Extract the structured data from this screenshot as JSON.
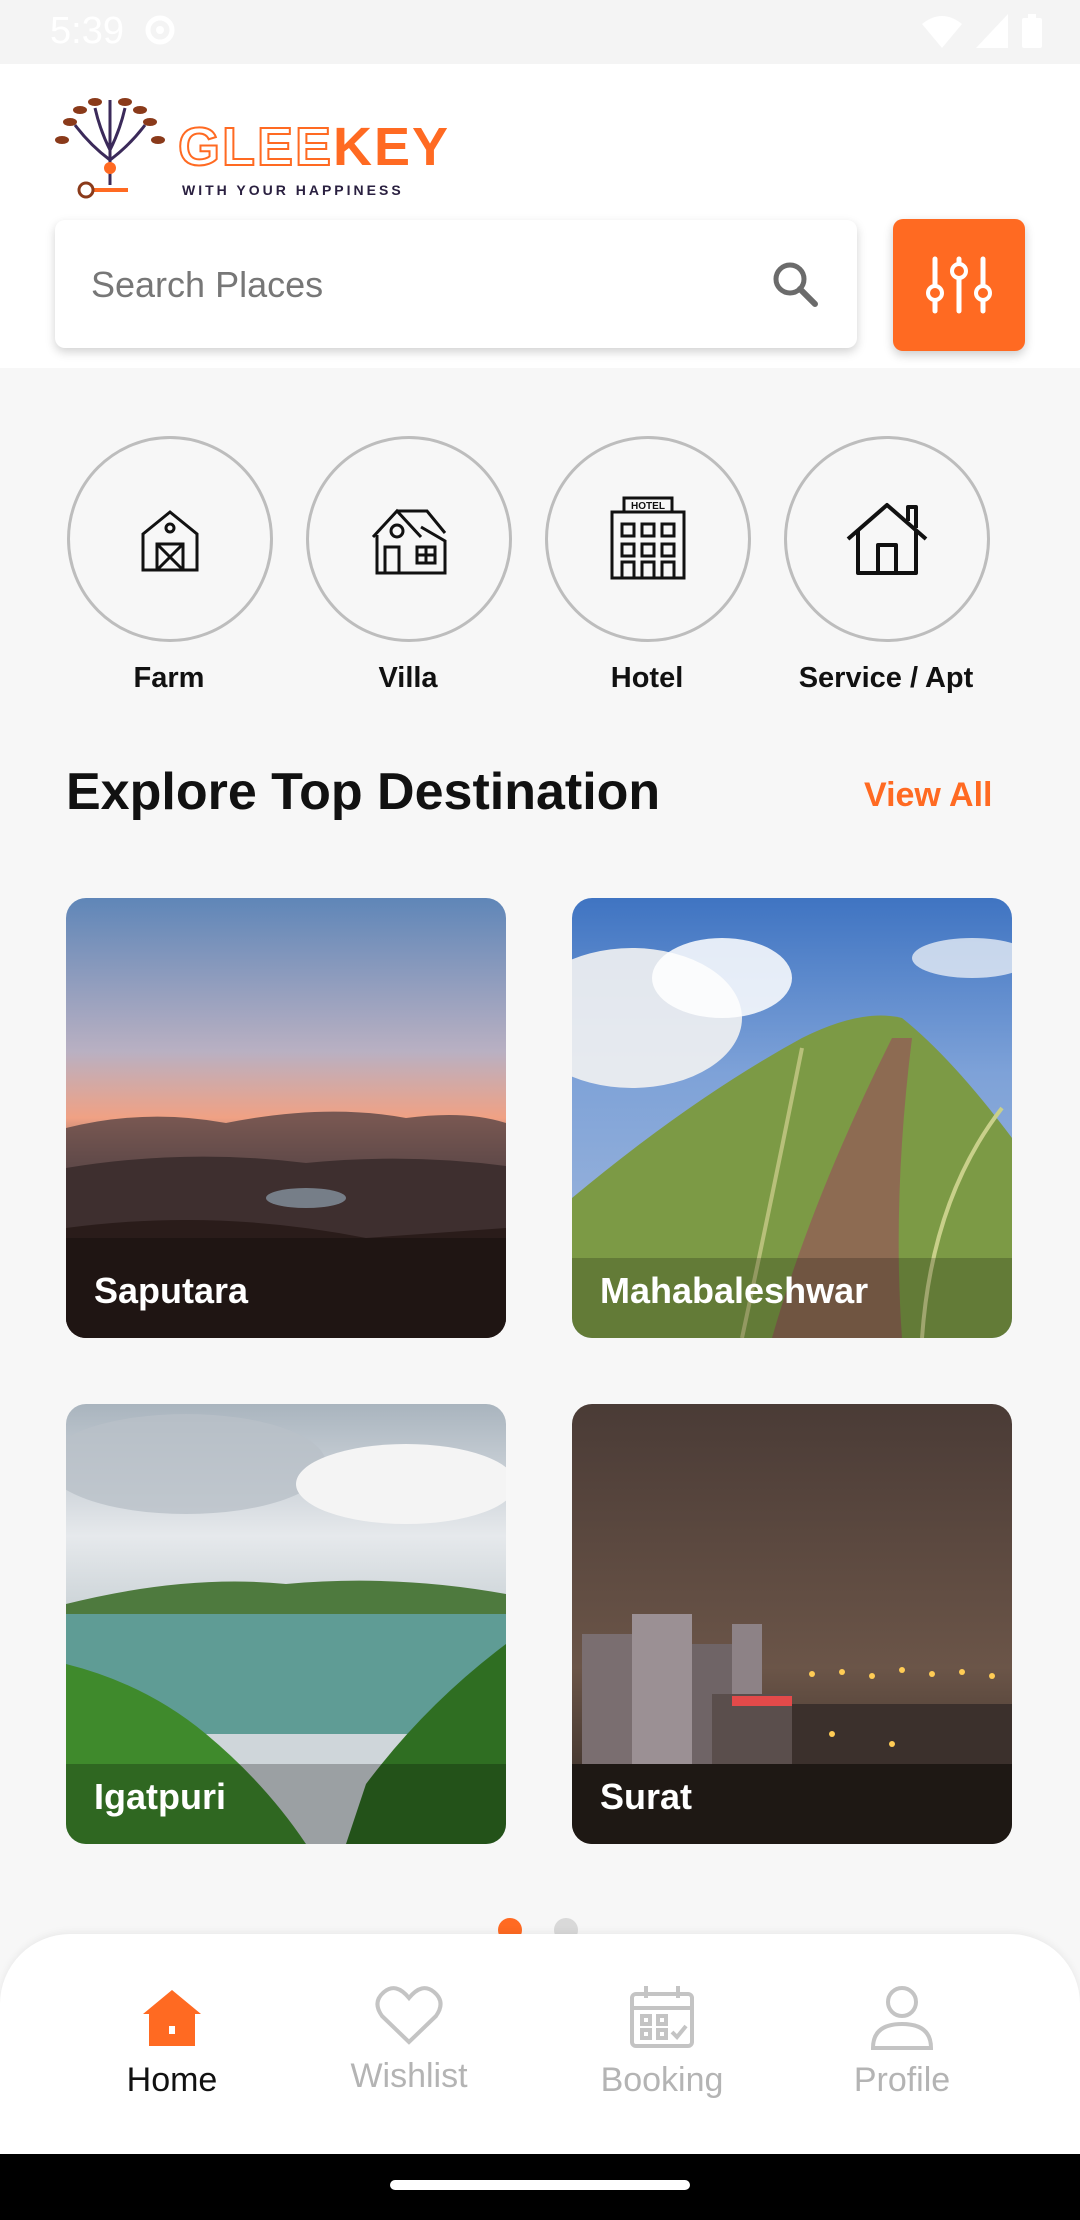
{
  "status_bar": {
    "time": "5:39"
  },
  "brand": {
    "name_part1": "GLEE",
    "name_part2": "KEY",
    "tagline": "WITH YOUR HAPPINESS"
  },
  "search": {
    "placeholder": "Search Places"
  },
  "categories": [
    {
      "label": "Farm",
      "icon": "barn-icon"
    },
    {
      "label": "Villa",
      "icon": "villa-icon"
    },
    {
      "label": "Hotel",
      "icon": "hotel-icon",
      "badge": "HOTEL"
    },
    {
      "label": "Service / Apt",
      "icon": "house-icon"
    }
  ],
  "section": {
    "title": "Explore Top Destination",
    "view_all": "View All"
  },
  "destinations": [
    {
      "name": "Saputara"
    },
    {
      "name": "Mahabaleshwar"
    },
    {
      "name": "Igatpuri"
    },
    {
      "name": "Surat"
    }
  ],
  "pager": {
    "pages": 2,
    "active": 1
  },
  "bottom_nav": {
    "items": [
      {
        "label": "Home",
        "icon": "home-icon",
        "active": true
      },
      {
        "label": "Wishlist",
        "icon": "heart-icon",
        "active": false
      },
      {
        "label": "Booking",
        "icon": "calendar-icon",
        "active": false
      },
      {
        "label": "Profile",
        "icon": "user-icon",
        "active": false
      }
    ]
  },
  "colors": {
    "accent": "#ff6a22",
    "background": "#f7f7f7"
  }
}
